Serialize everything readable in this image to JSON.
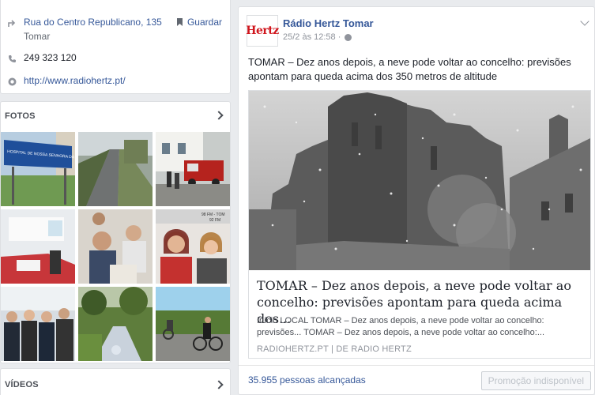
{
  "about": {
    "address_line1": "Rua do Centro Republicano, 135",
    "address_line2": "Tomar",
    "save_label": "Guardar",
    "phone": "249 323 120",
    "website": "http://www.radiohertz.pt/"
  },
  "photos": {
    "title": "FOTOS"
  },
  "videos": {
    "title": "VÍDEOS"
  },
  "post": {
    "page_name": "Rádio Hertz Tomar",
    "logo_text": "Hertz",
    "timestamp": "25/2 às 12:58 ·",
    "text": "TOMAR – Dez anos depois, a neve pode voltar ao concelho: previsões apontam para queda acima dos 350 metros de altitude",
    "link": {
      "title": "TOMAR – Dez anos depois, a neve pode voltar ao concelho: previsões apontam para queda acima dos...",
      "description": "Início LOCAL TOMAR – Dez anos depois, a neve pode voltar ao concelho: previsões... TOMAR – Dez anos depois, a neve pode voltar ao concelho:...",
      "source": "RADIOHERTZ.PT | DE RADIO HERTZ"
    },
    "reach": "35.955 pessoas alcançadas",
    "promo_label": "Promoção indisponível"
  },
  "photo_overlay_text": {
    "hospital_sign": "HOSPITAL DE NOSSA SENHORA DA GRAÇA",
    "radio_freq_1": "98 FM - TOM",
    "radio_freq_2": "92 FM"
  },
  "colors": {
    "link": "#365899",
    "brand_red": "#d0161d",
    "background": "#e9ebee"
  }
}
